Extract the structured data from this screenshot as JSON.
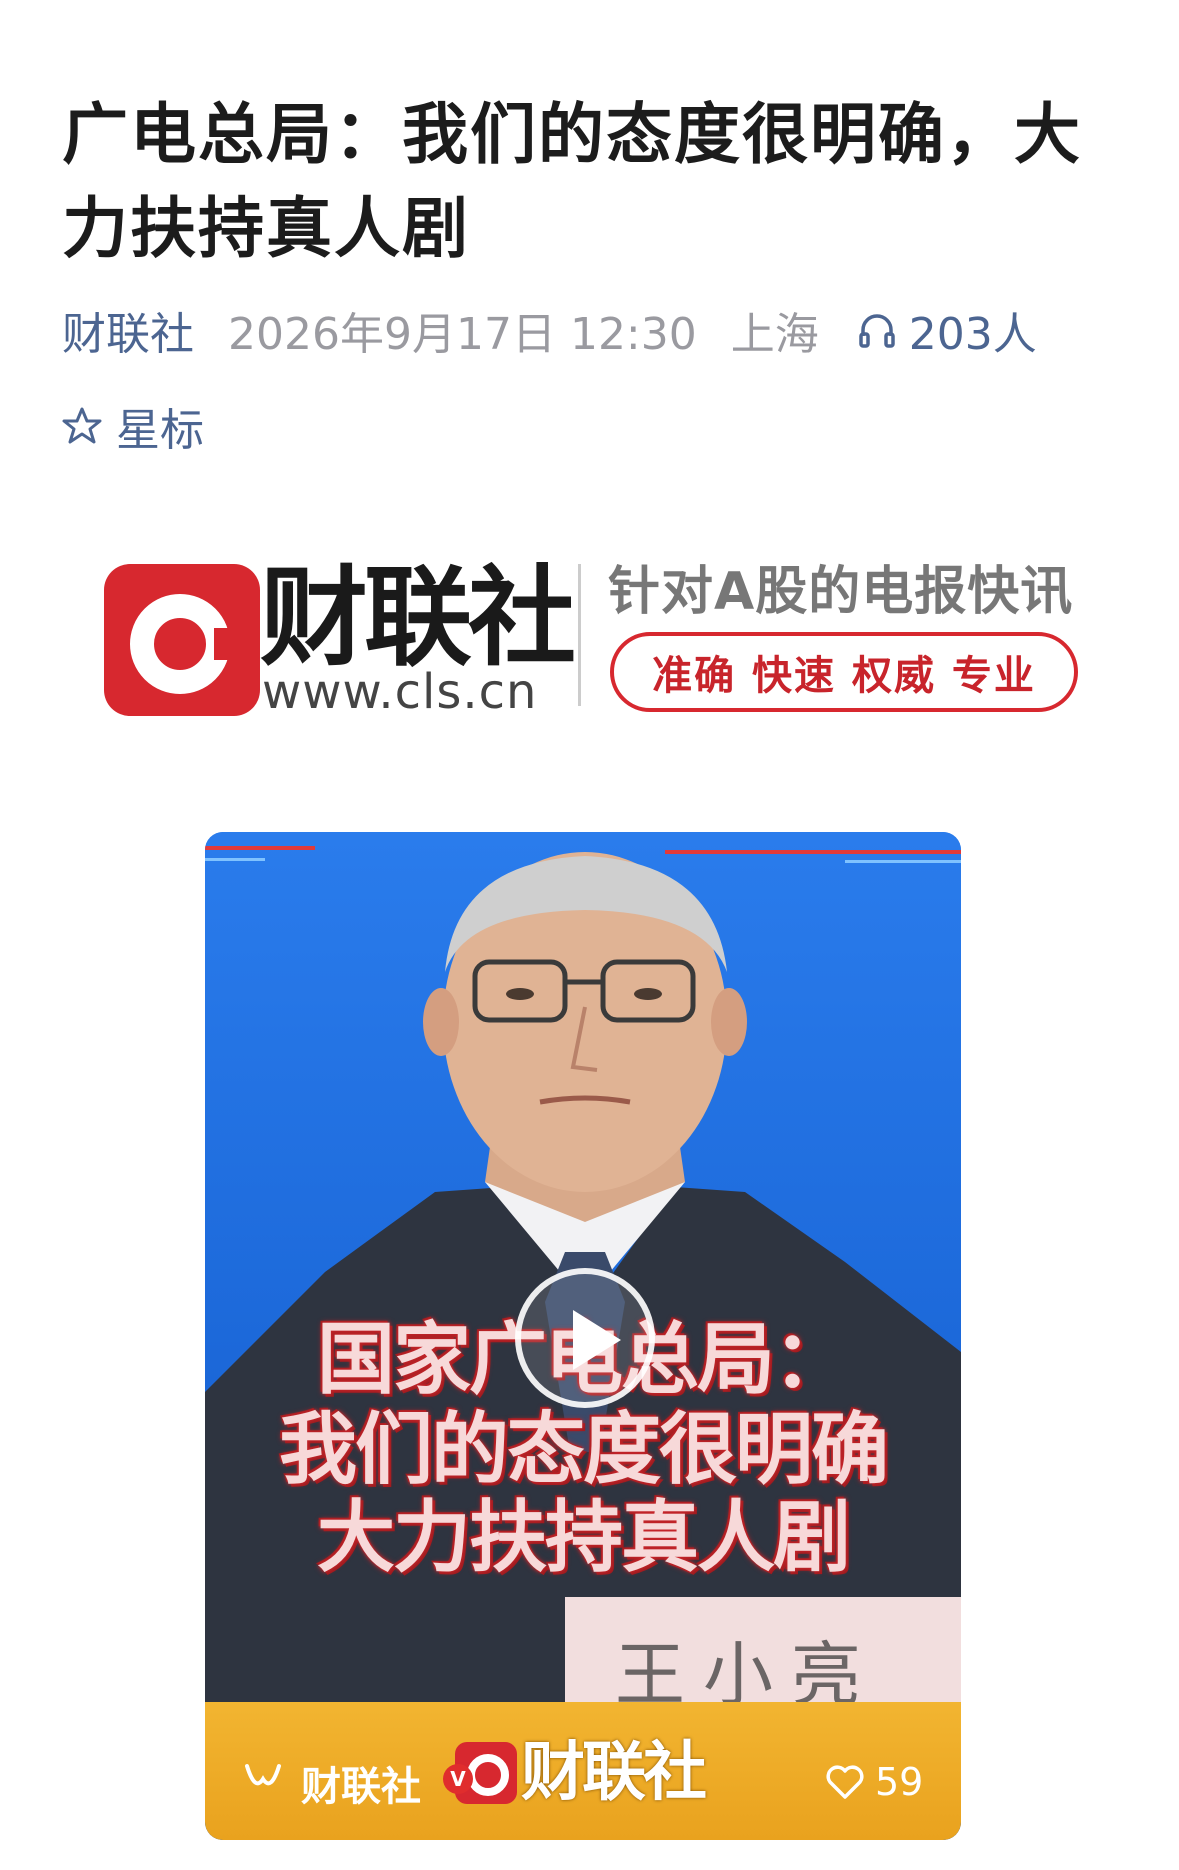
{
  "article": {
    "title": "广电总局：我们的态度很明确，大力扶持真人剧",
    "source": "财联社",
    "date": "2026年9月17日 12:30",
    "location": "上海",
    "listeners": "203人",
    "star_label": "星标"
  },
  "banner": {
    "brand": "财联社",
    "url": "www.cls.cn",
    "slogan": "针对A股的电报快讯",
    "tags": "准确 快速 权威 专业"
  },
  "video": {
    "caption_lines": [
      "国家广电总局：",
      "我们的态度很明确",
      "大力扶持真人剧"
    ],
    "nameplate": "王小亮",
    "channel": "财联社",
    "verified_badge": "V",
    "brand": "财联社",
    "likes": "59"
  },
  "colors": {
    "link": "#4c6591",
    "meta_gray": "#9a9aa0",
    "brand_red": "#d7282f",
    "video_blue": "#1f6fe0",
    "video_footer": "#f2b531"
  },
  "icons": [
    "headphones-icon",
    "star-icon",
    "play-icon",
    "channel-icon",
    "heart-icon"
  ]
}
